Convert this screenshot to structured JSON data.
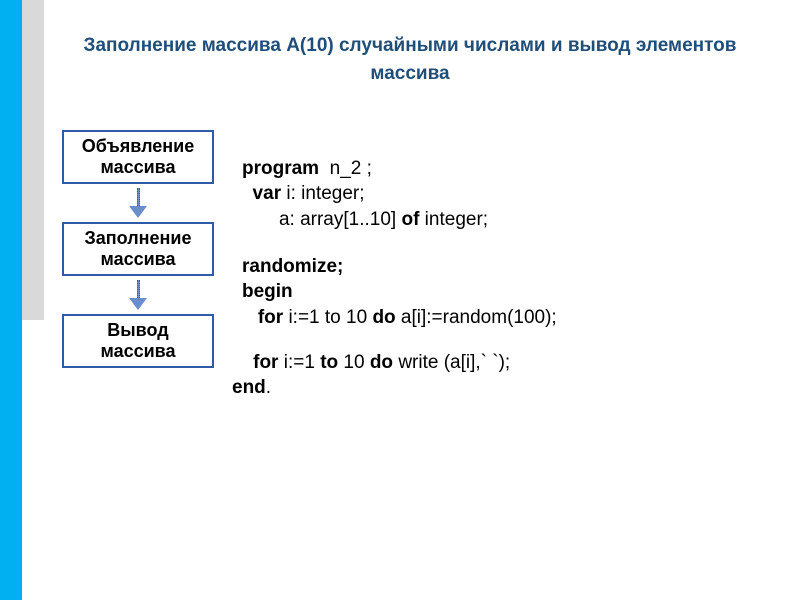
{
  "title": "Заполнение массива А(10) случайными числами и вывод элементов массива",
  "boxes": {
    "declare": "Объявление\nмассива",
    "fill": "Заполнение\nмассива",
    "output": "Вывод\nмассива"
  },
  "code": {
    "l1a": "program",
    "l1b": "  n_2 ;",
    "l2a": "  var",
    "l2b": " i: integer;",
    "l3a": "       a: array[1..10] ",
    "l3b": "of",
    "l3c": " integer;",
    "l4": "randomize;",
    "l5": "begin",
    "l6a": "   for",
    "l6b": " i:=1 to 10 ",
    "l6c": "do",
    "l6d": " a[i]:=random(100);",
    "l7a": "    for",
    "l7b": " i:=1 ",
    "l7c": "to",
    "l7d": " 10 ",
    "l7e": "do",
    "l7f": " write (a[i],` `);",
    "l8a": "end",
    "l8b": "."
  }
}
